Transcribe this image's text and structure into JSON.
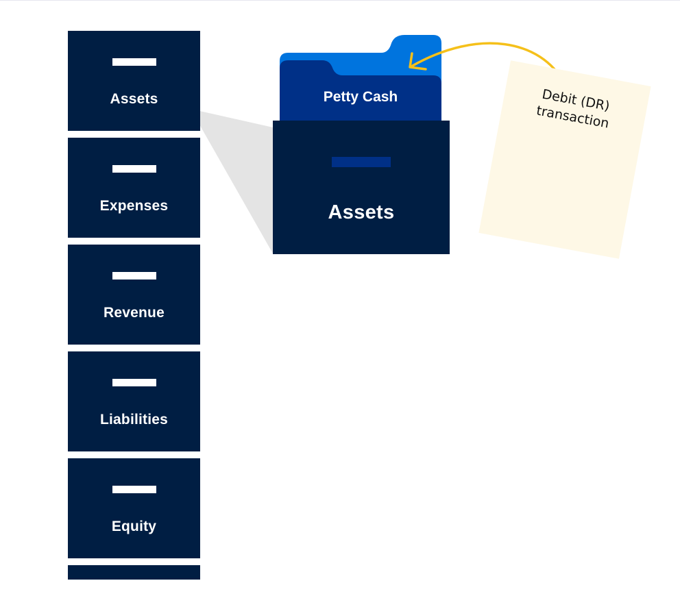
{
  "cabinet": {
    "drawers": [
      {
        "label": "Assets"
      },
      {
        "label": "Expenses"
      },
      {
        "label": "Revenue"
      },
      {
        "label": "Liabilities"
      },
      {
        "label": "Equity"
      }
    ]
  },
  "expanded_drawer": {
    "label": "Assets",
    "folder_label": "Petty Cash"
  },
  "note": {
    "line1": "Debit (DR)",
    "line2": "transaction"
  },
  "colors": {
    "drawer_navy": "#001E43",
    "folder_front": "#003087",
    "folder_back": "#0074DE",
    "arrow": "#F5C01A",
    "note_paper": "#FEF8E6",
    "callout_gray": "#E4E4E4"
  }
}
